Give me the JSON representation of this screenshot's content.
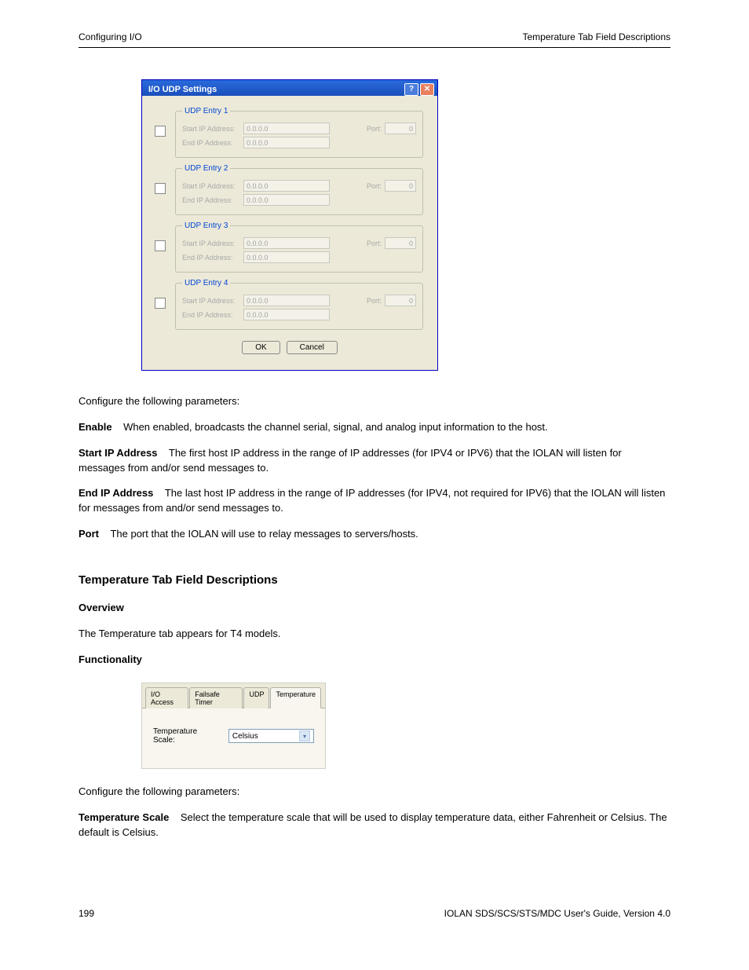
{
  "header": {
    "left": "Configuring I/O",
    "right": "Temperature Tab Field Descriptions"
  },
  "dialog": {
    "title": "I/O UDP Settings",
    "entries": [
      {
        "legend": "UDP Entry 1",
        "start_label": "Start IP Address:",
        "start_val": "0.0.0.0",
        "end_label": "End IP Address:",
        "end_val": "0.0.0.0",
        "port_label": "Port:",
        "port_val": "0"
      },
      {
        "legend": "UDP Entry 2",
        "start_label": "Start IP Address:",
        "start_val": "0.0.0.0",
        "end_label": "End IP Address:",
        "end_val": "0.0.0.0",
        "port_label": "Port:",
        "port_val": "0"
      },
      {
        "legend": "UDP Entry 3",
        "start_label": "Start IP Address:",
        "start_val": "0.0.0.0",
        "end_label": "End IP Address:",
        "end_val": "0.0.0.0",
        "port_label": "Port:",
        "port_val": "0"
      },
      {
        "legend": "UDP Entry 4",
        "start_label": "Start IP Address:",
        "start_val": "0.0.0.0",
        "end_label": "End IP Address:",
        "end_val": "0.0.0.0",
        "port_label": "Port:",
        "port_val": "0"
      }
    ],
    "ok": "OK",
    "cancel": "Cancel"
  },
  "body": {
    "p1": "Configure the following parameters:",
    "f_enable_t": "Enable",
    "f_enable_d": "When enabled, broadcasts the channel serial, signal, and analog input information to the host.",
    "f_start_t": "Start IP Address",
    "f_start_d": "The first host IP address in the range of IP addresses (for IPV4 or IPV6) that the IOLAN will listen for messages from and/or send messages to.",
    "f_end_t": "End IP Address",
    "f_end_d": "The last host IP address in the range of IP addresses (for IPV4, not required for IPV6) that the IOLAN will listen for messages from and/or send messages to.",
    "f_port_t": "Port",
    "f_port_d": "The port that the IOLAN will use to relay messages to servers/hosts."
  },
  "section2": {
    "heading": "Temperature Tab Field Descriptions",
    "overview_t": "Overview",
    "overview_p": "The Temperature tab appears for T4 models.",
    "funct_t": "Functionality"
  },
  "tabshot": {
    "tabs": [
      "I/O Access",
      "Failsafe Timer",
      "UDP",
      "Temperature"
    ],
    "active_index": 3,
    "label": "Temperature Scale:",
    "value": "Celsius"
  },
  "body2": {
    "p1": "Configure the following parameters:",
    "f_temp_t": "Temperature Scale",
    "f_temp_d": "Select the temperature scale that will be used to display temperature data, either Fahrenheit or Celsius. The default is Celsius."
  },
  "footer": {
    "left": "199",
    "right": "IOLAN SDS/SCS/STS/MDC User's Guide, Version 4.0"
  }
}
